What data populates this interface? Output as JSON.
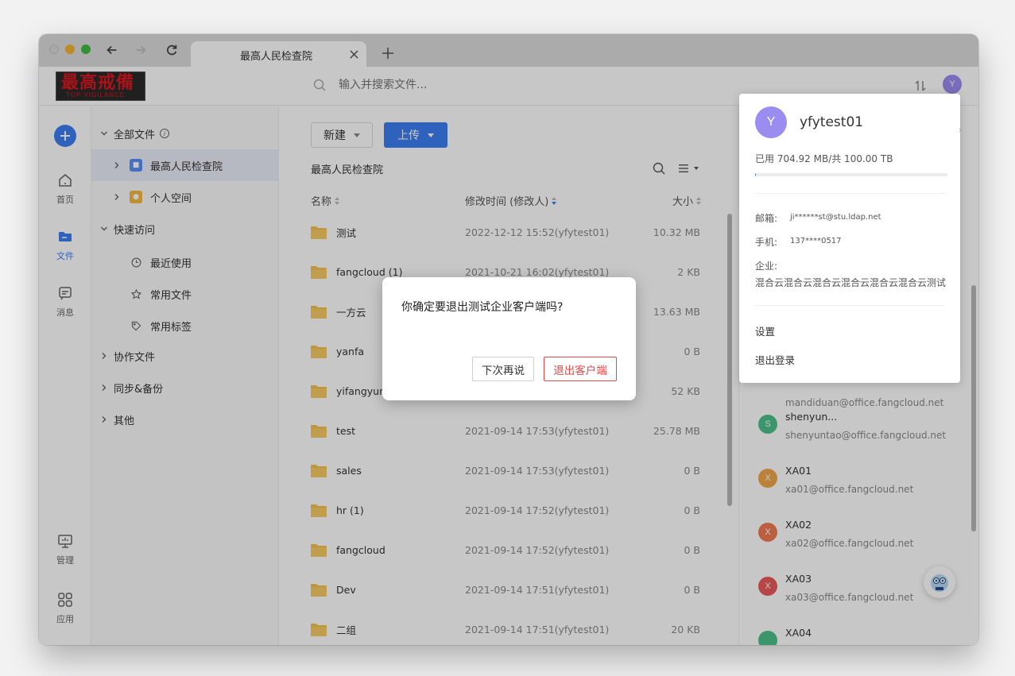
{
  "browser": {
    "tab_title": "最高人民检查院"
  },
  "header": {
    "logo_text": "最高戒備",
    "logo_subtext": "TOP VIGILANCE",
    "search_placeholder": "输入并搜索文件...",
    "avatar_initial": "Y"
  },
  "rail": {
    "items": [
      {
        "label": "首页",
        "icon": "home-icon"
      },
      {
        "label": "文件",
        "icon": "folder-icon"
      },
      {
        "label": "消息",
        "icon": "message-icon"
      },
      {
        "label": "管理",
        "icon": "monitor-icon"
      },
      {
        "label": "应用",
        "icon": "apps-icon"
      }
    ]
  },
  "tree": {
    "all_files": "全部文件",
    "org_space": "最高人民检查院",
    "personal_space": "个人空间",
    "quick_access": "快速访问",
    "recent": "最近使用",
    "frequent": "常用文件",
    "tags": "常用标签",
    "collab": "协作文件",
    "sync_backup": "同步&备份",
    "other": "其他"
  },
  "main": {
    "new_label": "新建",
    "upload_label": "上传",
    "breadcrumb": "最高人民检查院",
    "col_name": "名称",
    "col_modified": "修改时间 (修改人)",
    "col_size": "大小",
    "files": [
      {
        "name": "测试",
        "time": "2022-12-12 15:52(yfytest01)",
        "size": "10.32 MB"
      },
      {
        "name": "fangcloud (1)",
        "time": "2021-10-21 16:02(yfytest01)",
        "size": "2 KB"
      },
      {
        "name": "一方云",
        "time": "",
        "size": "13.63 MB"
      },
      {
        "name": "yanfa",
        "time": "",
        "size": "0 B"
      },
      {
        "name": "yifangyun",
        "time": "",
        "size": "52 KB"
      },
      {
        "name": "test",
        "time": "2021-09-14 17:53(yfytest01)",
        "size": "25.78 MB"
      },
      {
        "name": "sales",
        "time": "2021-09-14 17:53(yfytest01)",
        "size": "0 B"
      },
      {
        "name": "hr (1)",
        "time": "2021-09-14 17:52(yfytest01)",
        "size": "0 B"
      },
      {
        "name": "fangcloud",
        "time": "2021-09-14 17:52(yfytest01)",
        "size": "0 B"
      },
      {
        "name": "Dev",
        "time": "2021-09-14 17:51(yfytest01)",
        "size": "0 B"
      },
      {
        "name": "二组",
        "time": "2021-09-14 17:51(yfytest01)",
        "size": "20 KB"
      }
    ]
  },
  "members": [
    {
      "initial": "",
      "name": "",
      "email": "mandiduan@office.fangcloud.net",
      "color": "#7c7c7c"
    },
    {
      "initial": "S",
      "name": "shenyun...",
      "email": "shenyuntao@office.fangcloud.net",
      "color": "#4cc08a"
    },
    {
      "initial": "X",
      "name": "XA01",
      "email": "xa01@office.fangcloud.net",
      "color": "#f0a64a"
    },
    {
      "initial": "X",
      "name": "XA02",
      "email": "xa02@office.fangcloud.net",
      "color": "#f07a52"
    },
    {
      "initial": "X",
      "name": "XA03",
      "email": "xa03@office.fangcloud.net",
      "color": "#e95a5a"
    },
    {
      "initial": "",
      "name": "XA04",
      "email": "",
      "color": "#4cc08a"
    }
  ],
  "profile": {
    "initial": "Y",
    "username": "yfytest01",
    "quota": "已用 704.92 MB/共 100.00 TB",
    "quota_used_fraction": 6.7e-06,
    "email_label": "邮箱:",
    "email": "ji******st@stu.ldap.net",
    "phone_label": "手机:",
    "phone": "137****0517",
    "company_label": "企业:",
    "company": "混合云混合云混合云混合云混合云混合云测试",
    "settings": "设置",
    "logout": "退出登录"
  },
  "dialog": {
    "message": "你确定要退出测试企业客户端吗?",
    "later_label": "下次再说",
    "exit_label": "退出客户端"
  },
  "colors": {
    "accent": "#3d7ef3",
    "danger": "#e04a4a",
    "folder": "#f5c14e"
  }
}
